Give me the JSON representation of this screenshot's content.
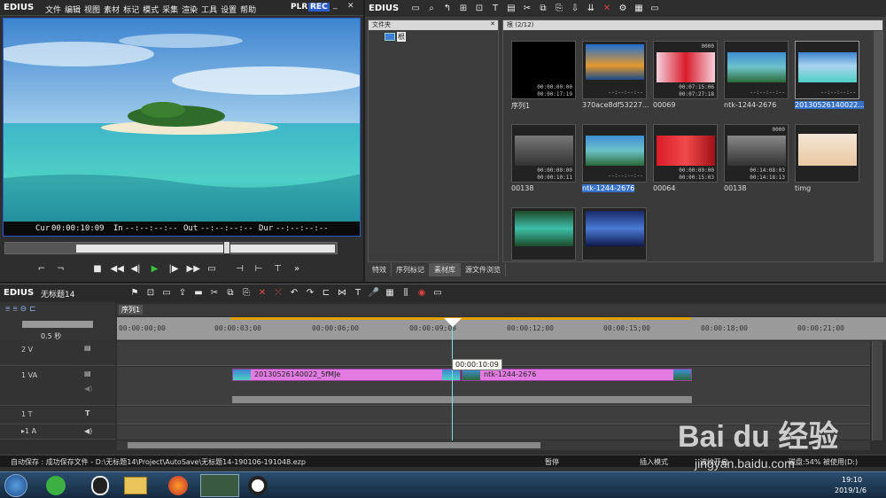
{
  "app": {
    "logo": "EDIUS",
    "menu": [
      "文件",
      "编辑",
      "视图",
      "素材",
      "标记",
      "模式",
      "采集",
      "渲染",
      "工具",
      "设置",
      "帮助"
    ],
    "plr": "PLR",
    "rec": "REC"
  },
  "player": {
    "cur_label": "Cur",
    "cur": "00:00:10:09",
    "in_label": "In",
    "in": "--:--:--:--",
    "out_label": "Out",
    "out": "--:--:--:--",
    "dur_label": "Dur",
    "dur": "--:--:--:--"
  },
  "bin": {
    "logo": "EDIUS",
    "folder_title": "文件夹",
    "root": "根",
    "count_title": "根 (2/12)",
    "clips": [
      {
        "name": "序列1",
        "tc1": "00:00:00:00",
        "tc2": "00:00:17:19",
        "badge": ""
      },
      {
        "name": "370ace8df53227...",
        "tc1": "--:--:--:--",
        "tc2": "",
        "badge": ""
      },
      {
        "name": "00069",
        "tc1": "00:07:15:06",
        "tc2": "00:07:27:18",
        "badge": "0000"
      },
      {
        "name": "ntk-1244-2676",
        "tc1": "--:--:--:--",
        "tc2": "",
        "badge": ""
      },
      {
        "name": "20130526140022...",
        "tc1": "--:--:--:--",
        "tc2": "",
        "badge": ""
      },
      {
        "name": "00138",
        "tc1": "00:00:00:00",
        "tc2": "00:00:10:11",
        "badge": ""
      },
      {
        "name": "ntk-1244-2676",
        "tc1": "--:--:--:--",
        "tc2": "",
        "badge": ""
      },
      {
        "name": "00064",
        "tc1": "00:00:00:00",
        "tc2": "00:00:15:03",
        "badge": ""
      },
      {
        "name": "00138",
        "tc1": "00:14:08:03",
        "tc2": "00:14:18:13",
        "badge": "0000"
      },
      {
        "name": "timg",
        "tc1": "--:--:--:--",
        "tc2": "",
        "badge": ""
      },
      {
        "name": "",
        "tc1": "",
        "tc2": "",
        "badge": ""
      },
      {
        "name": "",
        "tc1": "",
        "tc2": "",
        "badge": ""
      }
    ],
    "tabs": [
      "特效",
      "序列标记",
      "素材库",
      "源文件浏览"
    ]
  },
  "timeline": {
    "logo": "EDIUS",
    "project": "无标题14",
    "sequence_tab": "序列1",
    "zoom": "0.5 秒",
    "ruler": [
      "00:00:00;00",
      "00:00:03;00",
      "00:00:06;00",
      "00:00:09;00",
      "00:00:12;00",
      "00:00:15;00",
      "00:00:18;00",
      "00:00:21;00"
    ],
    "tracks": [
      "2 V",
      "1 VA",
      "1 T",
      "▸1 A"
    ],
    "clip1": "20130526140022_5fMJe",
    "clip2": "ntk-1244-2676",
    "tooltip": "00:00:10:09"
  },
  "status": {
    "autosave": "自动保存 :  成功保存文件 - D:\\无标题14\\Project\\AutoSave\\无标题14-190106-191048.ezp",
    "pause": "暂停",
    "insert": "插入模式",
    "ripple": "波纹开启",
    "disk": "磁盘:54% 被使用(D:)"
  },
  "taskbar": {
    "time": "19:10",
    "date": "2019/1/6"
  },
  "watermark": {
    "text": "Bai du 经验",
    "url": "jingyan.baidu.com"
  }
}
